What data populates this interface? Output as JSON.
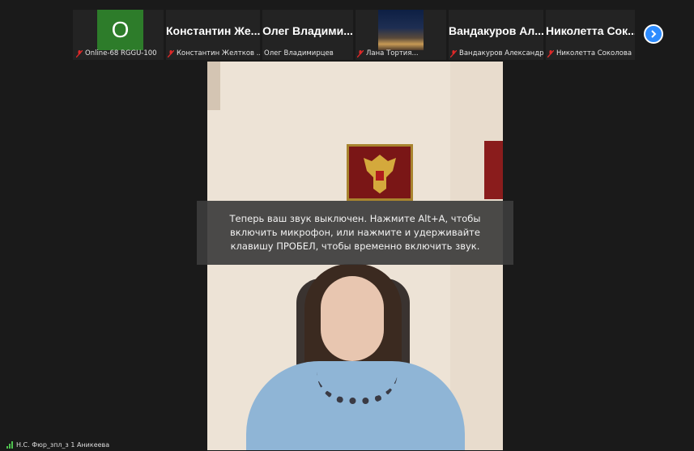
{
  "gallery": {
    "tiles": [
      {
        "avatar_letter": "O",
        "caption": "Online-68 RGGU-100"
      },
      {
        "display_name": "Константин Же...",
        "caption": "Константин Желтков ..."
      },
      {
        "display_name": "Олег Владими...",
        "caption": "Олег Владимирцев"
      },
      {
        "caption": "Лана Тортия..."
      },
      {
        "display_name": "Вандакуров Ал...",
        "caption": "Вандакуров Александр"
      },
      {
        "display_name": "Николетта Сок...",
        "caption": "Николетта Соколова"
      }
    ]
  },
  "notification": {
    "line1": "Теперь ваш звук выключен. Нажмите Alt+A, чтобы",
    "line2": "включить микрофон, или нажмите и удерживайте",
    "line3": "клавишу ПРОБЕЛ, чтобы временно включить звук."
  },
  "active_speaker": {
    "label": "Н.С. Фюр_зпл_з 1 Аникеева"
  },
  "colors": {
    "accent": "#2d8cff",
    "mute": "#e02828",
    "avatar_bg": "#2d7c2a",
    "background": "#1a1a1a"
  },
  "icons": {
    "mute": "muted-mic-icon",
    "next": "chevron-right-icon",
    "signal": "signal-strength-icon"
  }
}
